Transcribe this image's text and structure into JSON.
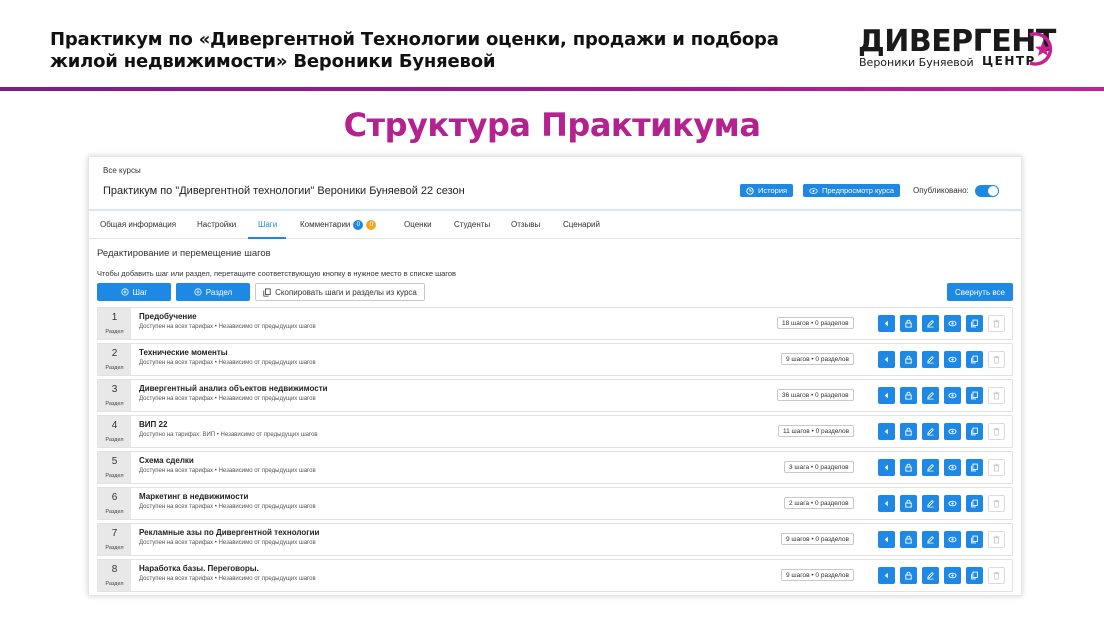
{
  "slide": {
    "title": "Практикум по «Дивергентной Технологии оценки, продажи и подбора жилой недвижимости» Вероники  Буняевой",
    "section_title": "Структура Практикума"
  },
  "logo": {
    "word": "ДИВЕРГЕНТ",
    "subtitle": "Вероники Буняевой",
    "center": "ЦЕНТР",
    "accent_color": "#c8208f"
  },
  "app": {
    "breadcrumb": "Все курсы",
    "course_title": "Практикум по \"Дивергентной технологии\" Вероники Буняевой 22 сезон",
    "history_label": "История",
    "preview_label": "Предпросмотр курса",
    "published_label": "Опубликовано:",
    "published": true,
    "accent_color": "#1e88e5",
    "tabs": [
      {
        "label": "Общая информация"
      },
      {
        "label": "Настройки"
      },
      {
        "label": "Шаги",
        "active": true
      },
      {
        "label": "Комментарии",
        "badge1": "0",
        "badge2": "0"
      },
      {
        "label": "Оценки"
      },
      {
        "label": "Студенты"
      },
      {
        "label": "Отзывы"
      },
      {
        "label": "Сценарий"
      }
    ],
    "edit_title": "Редактирование и перемещение шагов",
    "hint": "Чтобы добавить шаг или раздел, перетащите соответствующую кнопку в нужное место в списке шагов",
    "btn_step": "Шаг",
    "btn_section": "Раздел",
    "btn_copy": "Скопировать шаги и разделы из курса",
    "btn_collapse": "Свернуть все",
    "section_label": "Раздел",
    "sections": [
      {
        "num": "1",
        "name": "Предобучение",
        "access": "Доступен на всех тарифах",
        "dependency": "Независимо от предыдущих шагов",
        "count": "18 шагов • 0 разделов"
      },
      {
        "num": "2",
        "name": "Технические моменты",
        "access": "Доступен на всех тарифах",
        "dependency": "Независимо от предыдущих шагов",
        "count": "9 шагов • 0 разделов"
      },
      {
        "num": "3",
        "name": "Дивергентный анализ объектов недвижимости",
        "access": "Доступен на всех тарифах",
        "dependency": "Независимо от предыдущих шагов",
        "count": "36 шагов • 0 разделов"
      },
      {
        "num": "4",
        "name": "ВИП 22",
        "access": "Доступно на тарифах: ВИП",
        "dependency": "Независимо от предыдущих шагов",
        "count": "11 шагов • 0 разделов"
      },
      {
        "num": "5",
        "name": "Схема сделки",
        "access": "Доступен на всех тарифах",
        "dependency": "Независимо от предыдущих шагов",
        "count": "3 шага • 0 разделов"
      },
      {
        "num": "6",
        "name": "Маркетинг в недвижимости",
        "access": "Доступен на всех тарифах",
        "dependency": "Независимо от предыдущих шагов",
        "count": "2 шага • 0 разделов"
      },
      {
        "num": "7",
        "name": "Рекламные азы по Дивергентной технологии",
        "access": "Доступен на всех тарифах",
        "dependency": "Независимо от предыдущих шагов",
        "count": "9 шагов • 0 разделов"
      },
      {
        "num": "8",
        "name": "Наработка базы. Переговоры.",
        "access": "Доступен на всех тарифах",
        "dependency": "Независимо от предыдущих шагов",
        "count": "9 шагов • 0 разделов"
      }
    ],
    "row_actions": [
      "arrow-left-icon",
      "lock-icon",
      "edit-icon",
      "eye-icon",
      "copy-icon",
      "trash-icon"
    ]
  }
}
